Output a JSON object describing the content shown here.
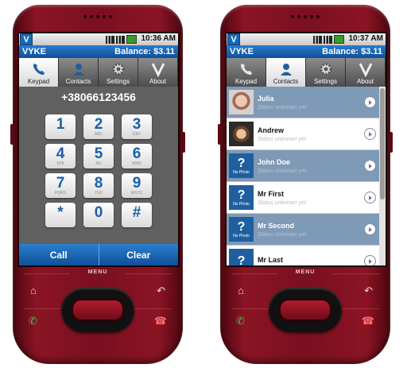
{
  "left_screen": {
    "status_time": "10:36 AM",
    "logo": "V",
    "app_name": "VYKE",
    "balance": "Balance: $3.11",
    "tabs": [
      {
        "label": "Keypad",
        "icon": "phone-handset-icon",
        "active": true
      },
      {
        "label": "Contacts",
        "icon": "person-icon",
        "active": false
      },
      {
        "label": "Settings",
        "icon": "gear-icon",
        "active": false
      },
      {
        "label": "About",
        "icon": "v-logo-icon",
        "active": false
      }
    ],
    "dialed_number": "+38066123456",
    "keys": [
      {
        "digit": "1",
        "letters": ""
      },
      {
        "digit": "2",
        "letters": "ABC"
      },
      {
        "digit": "3",
        "letters": "DEF"
      },
      {
        "digit": "4",
        "letters": "GHI"
      },
      {
        "digit": "5",
        "letters": "JKL"
      },
      {
        "digit": "6",
        "letters": "MNO"
      },
      {
        "digit": "7",
        "letters": "PQRS"
      },
      {
        "digit": "8",
        "letters": "TUV"
      },
      {
        "digit": "9",
        "letters": "WXYZ"
      },
      {
        "digit": "*",
        "letters": ""
      },
      {
        "digit": "0",
        "letters": ""
      },
      {
        "digit": "#",
        "letters": ""
      }
    ],
    "call_label": "Call",
    "clear_label": "Clear"
  },
  "right_screen": {
    "status_time": "10:37 AM",
    "logo": "V",
    "app_name": "VYKE",
    "balance": "Balance: $3.11",
    "tabs": [
      {
        "label": "Keypad",
        "icon": "phone-handset-icon",
        "active": false
      },
      {
        "label": "Contacts",
        "icon": "person-icon",
        "active": true
      },
      {
        "label": "Settings",
        "icon": "gear-icon",
        "active": false
      },
      {
        "label": "About",
        "icon": "v-logo-icon",
        "active": false
      }
    ],
    "no_photo_label": "No Photo",
    "contacts": [
      {
        "name": "Julia",
        "status": "Status unknown yet",
        "photo": "portrait"
      },
      {
        "name": "Andrew",
        "status": "Status unknown yet",
        "photo": "portrait"
      },
      {
        "name": "John Doe",
        "status": "Status unknown yet",
        "photo": "none"
      },
      {
        "name": "Mr First",
        "status": "Status unknown yet",
        "photo": "none"
      },
      {
        "name": "Mr Second",
        "status": "Status unknown yet",
        "photo": "none"
      },
      {
        "name": "Mr Last",
        "status": "",
        "photo": "none"
      }
    ]
  },
  "device": {
    "menu_label": "MENU",
    "hardware_buttons": [
      "home-icon",
      "back-icon",
      "call-icon",
      "end-call-icon"
    ]
  },
  "colors": {
    "phone_body": "#7a1020",
    "title_blue": "#1967b3",
    "selected_row": "#7f9ab7",
    "digit_blue": "#1a5fa8"
  }
}
